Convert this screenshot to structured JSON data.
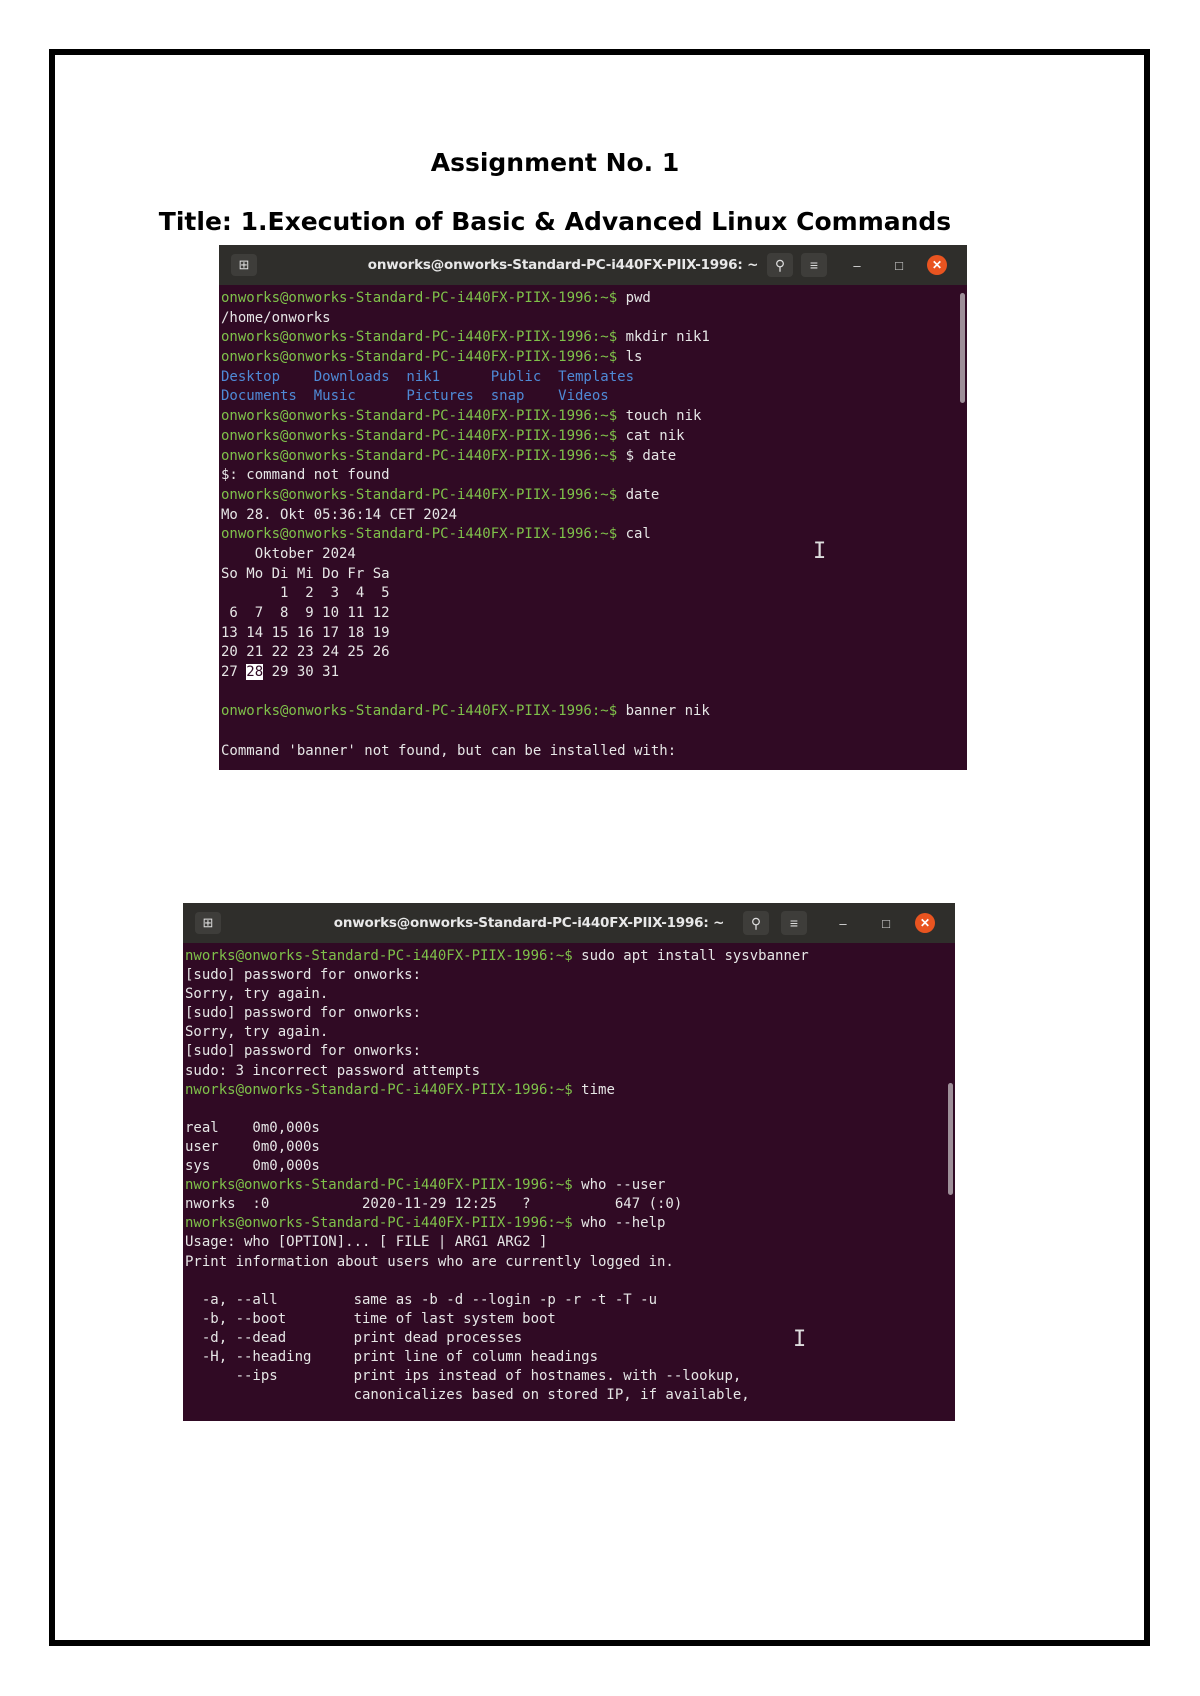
{
  "document": {
    "heading": "Assignment No. 1",
    "title": "Title: 1.Execution of Basic & Advanced Linux Commands"
  },
  "terminal1": {
    "window_title": "onworks@onworks-Standard-PC-i440FX-PIIX-1996: ~",
    "lines": [
      [
        {
          "t": "onworks@onworks-Standard-PC-i440FX-PIIX-1996:~$ ",
          "c": "prompt"
        },
        {
          "t": "pwd"
        }
      ],
      [
        {
          "t": "/home/onworks"
        }
      ],
      [
        {
          "t": "onworks@onworks-Standard-PC-i440FX-PIIX-1996:~$ ",
          "c": "prompt"
        },
        {
          "t": "mkdir nik1"
        }
      ],
      [
        {
          "t": "onworks@onworks-Standard-PC-i440FX-PIIX-1996:~$ ",
          "c": "prompt"
        },
        {
          "t": "ls"
        }
      ],
      [
        {
          "t": "Desktop    Downloads  nik1      Public  Templates",
          "c": "dir"
        }
      ],
      [
        {
          "t": "Documents  Music      Pictures  snap    Videos",
          "c": "dir"
        }
      ],
      [
        {
          "t": "onworks@onworks-Standard-PC-i440FX-PIIX-1996:~$ ",
          "c": "prompt"
        },
        {
          "t": "touch nik"
        }
      ],
      [
        {
          "t": "onworks@onworks-Standard-PC-i440FX-PIIX-1996:~$ ",
          "c": "prompt"
        },
        {
          "t": "cat nik"
        }
      ],
      [
        {
          "t": "onworks@onworks-Standard-PC-i440FX-PIIX-1996:~$ ",
          "c": "prompt"
        },
        {
          "t": "$ date"
        }
      ],
      [
        {
          "t": "$: command not found"
        }
      ],
      [
        {
          "t": "onworks@onworks-Standard-PC-i440FX-PIIX-1996:~$ ",
          "c": "prompt"
        },
        {
          "t": "date"
        }
      ],
      [
        {
          "t": "Mo 28. Okt 05:36:14 CET 2024"
        }
      ],
      [
        {
          "t": "onworks@onworks-Standard-PC-i440FX-PIIX-1996:~$ ",
          "c": "prompt"
        },
        {
          "t": "cal"
        }
      ],
      [
        {
          "t": "    Oktober 2024"
        }
      ],
      [
        {
          "t": "So Mo Di Mi Do Fr Sa"
        }
      ],
      [
        {
          "t": "       1  2  3  4  5"
        }
      ],
      [
        {
          "t": " 6  7  8  9 10 11 12"
        }
      ],
      [
        {
          "t": "13 14 15 16 17 18 19"
        }
      ],
      [
        {
          "t": "20 21 22 23 24 25 26"
        }
      ],
      [
        {
          "t": "27 "
        },
        {
          "t": "28",
          "c": "hl"
        },
        {
          "t": " 29 30 31"
        }
      ],
      [
        {
          "t": " "
        }
      ],
      [
        {
          "t": "onworks@onworks-Standard-PC-i440FX-PIIX-1996:~$ ",
          "c": "prompt"
        },
        {
          "t": "banner nik"
        }
      ],
      [
        {
          "t": " "
        }
      ],
      [
        {
          "t": "Command 'banner' not found, but can be installed with:"
        }
      ]
    ]
  },
  "terminal2": {
    "window_title": "onworks@onworks-Standard-PC-i440FX-PIIX-1996: ~",
    "lines": [
      [
        {
          "t": "nworks@onworks-Standard-PC-i440FX-PIIX-1996:~$ ",
          "c": "prompt"
        },
        {
          "t": "sudo apt install sysvbanner"
        }
      ],
      [
        {
          "t": "[sudo] password for onworks:"
        }
      ],
      [
        {
          "t": "Sorry, try again."
        }
      ],
      [
        {
          "t": "[sudo] password for onworks:"
        }
      ],
      [
        {
          "t": "Sorry, try again."
        }
      ],
      [
        {
          "t": "[sudo] password for onworks:"
        }
      ],
      [
        {
          "t": "sudo: 3 incorrect password attempts"
        }
      ],
      [
        {
          "t": "nworks@onworks-Standard-PC-i440FX-PIIX-1996:~$ ",
          "c": "prompt"
        },
        {
          "t": "time"
        }
      ],
      [
        {
          "t": " "
        }
      ],
      [
        {
          "t": "real    0m0,000s"
        }
      ],
      [
        {
          "t": "user    0m0,000s"
        }
      ],
      [
        {
          "t": "sys     0m0,000s"
        }
      ],
      [
        {
          "t": "nworks@onworks-Standard-PC-i440FX-PIIX-1996:~$ ",
          "c": "prompt"
        },
        {
          "t": "who --user"
        }
      ],
      [
        {
          "t": "nworks  :0           2020-11-29 12:25   ?          647 (:0)"
        }
      ],
      [
        {
          "t": "nworks@onworks-Standard-PC-i440FX-PIIX-1996:~$ ",
          "c": "prompt"
        },
        {
          "t": "who --help"
        }
      ],
      [
        {
          "t": "Usage: who [OPTION]... [ FILE | ARG1 ARG2 ]"
        }
      ],
      [
        {
          "t": "Print information about users who are currently logged in."
        }
      ],
      [
        {
          "t": " "
        }
      ],
      [
        {
          "t": "  -a, --all         same as -b -d --login -p -r -t -T -u"
        }
      ],
      [
        {
          "t": "  -b, --boot        time of last system boot"
        }
      ],
      [
        {
          "t": "  -d, --dead        print dead processes"
        }
      ],
      [
        {
          "t": "  -H, --heading     print line of column headings"
        }
      ],
      [
        {
          "t": "      --ips         print ips instead of hostnames. with --lookup,"
        }
      ],
      [
        {
          "t": "                    canonicalizes based on stored IP, if available,"
        }
      ]
    ]
  },
  "icons": {
    "new_tab": "new-tab-icon",
    "search": "search-icon",
    "menu": "hamburger-menu-icon",
    "minimize": "minimize-icon",
    "maximize": "maximize-icon",
    "close": "close-icon"
  },
  "colors": {
    "terminal_bg": "#300a24",
    "titlebar_bg": "#2f2e2b",
    "prompt": "#7fc14a",
    "directory": "#4f8ad6",
    "close_button": "#e95420"
  }
}
